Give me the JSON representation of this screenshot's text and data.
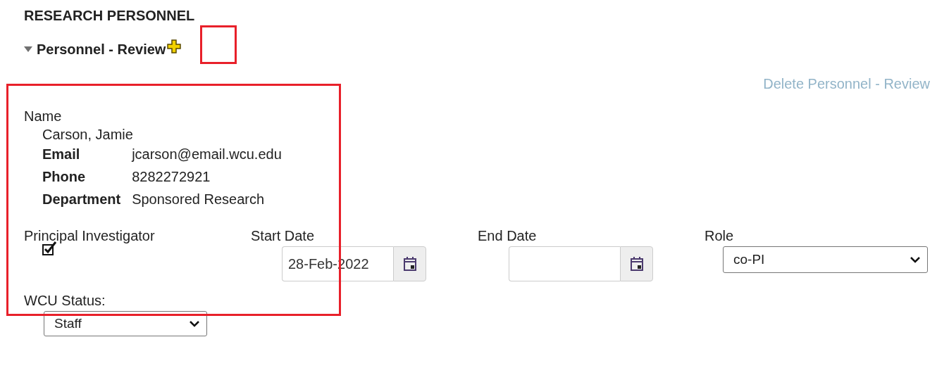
{
  "section_title": "RESEARCH PERSONNEL",
  "group": {
    "title": "Personnel - Review",
    "expanded": true
  },
  "delete_link": "Delete Personnel - Review",
  "person": {
    "label": "Name",
    "name": "Carson, Jamie",
    "details": [
      {
        "label": "Email",
        "value": "jcarson@email.wcu.edu"
      },
      {
        "label": "Phone",
        "value": "8282272921"
      },
      {
        "label": "Department",
        "value": "Sponsored Research"
      }
    ]
  },
  "principal_investigator": {
    "label": "Principal Investigator",
    "checked": true
  },
  "start_date": {
    "label": "Start Date",
    "value": "28-Feb-2022"
  },
  "end_date": {
    "label": "End Date"
  },
  "role": {
    "label": "Role",
    "value": "co-PI"
  },
  "wcu_status": {
    "label": "WCU Status:",
    "value": "Staff"
  }
}
